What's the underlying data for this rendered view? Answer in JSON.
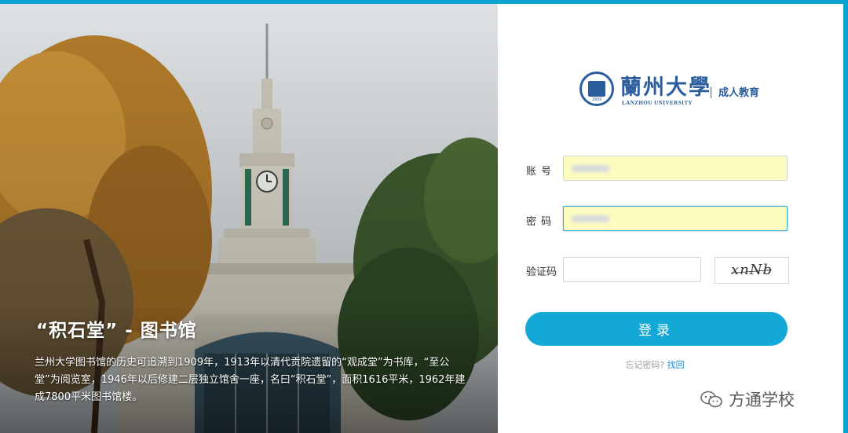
{
  "photo": {
    "caption_title": "“积石堂” - 图书馆",
    "caption_body": "兰州大学图书馆的历史可追溯到1909年，1913年以清代贡院遗留的“观成堂”为书库，“至公堂”为阅览室，1946年以后修建二层独立馆舍一座，名曰“积石堂”，面积1616平米，1962年建成7800平米图书馆楼。"
  },
  "brand": {
    "name_cn": "蘭州大學",
    "name_en": "LANZHOU UNIVERSITY",
    "subtitle": "成人教育",
    "seal_text": "1909"
  },
  "form": {
    "account_label": "账 号",
    "password_label": "密 码",
    "captcha_label": "验证码",
    "captcha_code": "xnNb",
    "login_label": "登录",
    "forgot_text": "忘记密码?",
    "forgot_link": "找回"
  },
  "watermark": {
    "text": "方通学校",
    "icon": "wechat-icon"
  },
  "colors": {
    "accent": "#13a8d6",
    "brand": "#2c5e9e",
    "autofill": "#fcfcc0"
  }
}
